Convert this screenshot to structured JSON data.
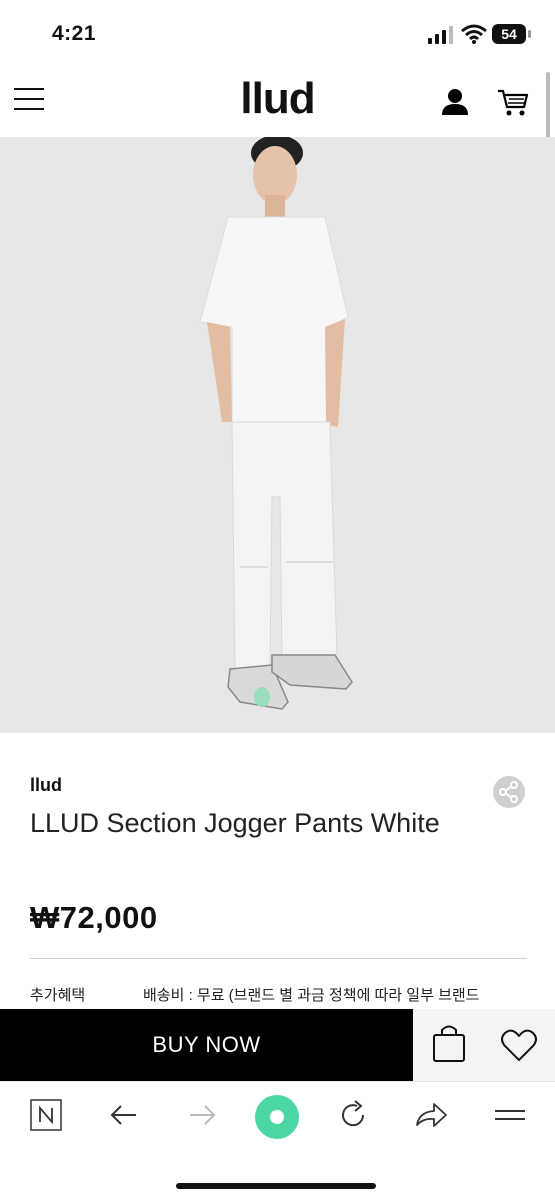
{
  "status_bar": {
    "time": "4:21",
    "battery": "54"
  },
  "header": {
    "logo": "llud"
  },
  "product": {
    "brand": "llud",
    "name": "LLUD Section Jogger Pants White",
    "price": "₩72,000",
    "benefits_label": "추가혜택",
    "benefits_value": "배송비 : 무료 (브랜드 별 과금 정책에 따라 일부 브랜드"
  },
  "actions": {
    "buy_now": "BUY NOW"
  },
  "colors": {
    "accent": "#000000",
    "page_bg": "#ffffff",
    "photo_bg": "#e7e7e7",
    "browser_home": "#4cd6a2"
  },
  "icons": [
    "menu-icon",
    "user-icon",
    "cart-icon",
    "share-icon",
    "shopping-bag-icon",
    "heart-icon",
    "naver-icon",
    "back-arrow-icon",
    "forward-arrow-icon",
    "home-circle-icon",
    "refresh-icon",
    "share-arrow-icon",
    "more-menu-icon"
  ]
}
